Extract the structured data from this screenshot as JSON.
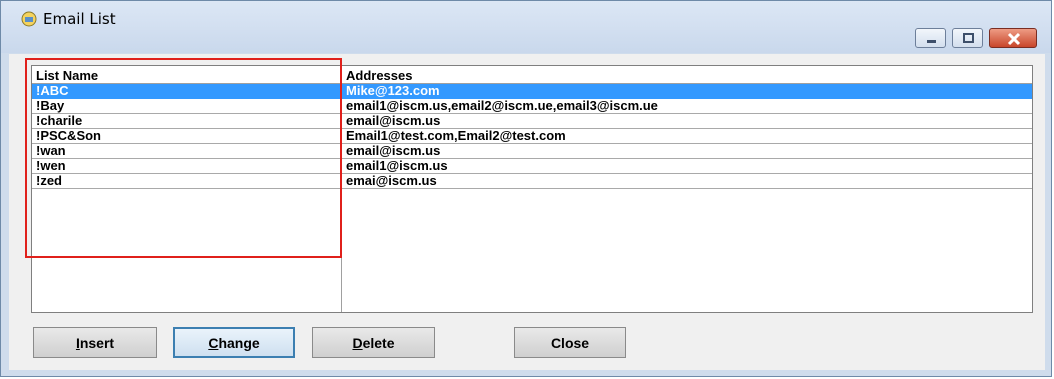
{
  "window": {
    "title": "Email List"
  },
  "listview": {
    "columns": [
      "List Name",
      "Addresses"
    ],
    "rows": [
      {
        "name": "!ABC",
        "addresses": "Mike@123.com",
        "selected": true
      },
      {
        "name": "!Bay",
        "addresses": "email1@iscm.us,email2@iscm.ue,email3@iscm.ue",
        "selected": false
      },
      {
        "name": "!charile",
        "addresses": "email@iscm.us",
        "selected": false
      },
      {
        "name": "!PSC&Son",
        "addresses": "Email1@test.com,Email2@test.com",
        "selected": false
      },
      {
        "name": "!wan",
        "addresses": "email@iscm.us",
        "selected": false
      },
      {
        "name": "!wen",
        "addresses": "email1@iscm.us",
        "selected": false
      },
      {
        "name": "!zed",
        "addresses": "emai@iscm.us",
        "selected": false
      }
    ]
  },
  "buttons": {
    "insert": {
      "mnemonic": "I",
      "rest": "nsert"
    },
    "change": {
      "mnemonic": "C",
      "rest": "hange"
    },
    "delete": {
      "mnemonic": "D",
      "rest": "elete"
    },
    "close": {
      "label": "Close"
    }
  },
  "colors": {
    "selection": "#3399ff",
    "annotation": "#e0201b",
    "focus": "#3c7fb1"
  }
}
